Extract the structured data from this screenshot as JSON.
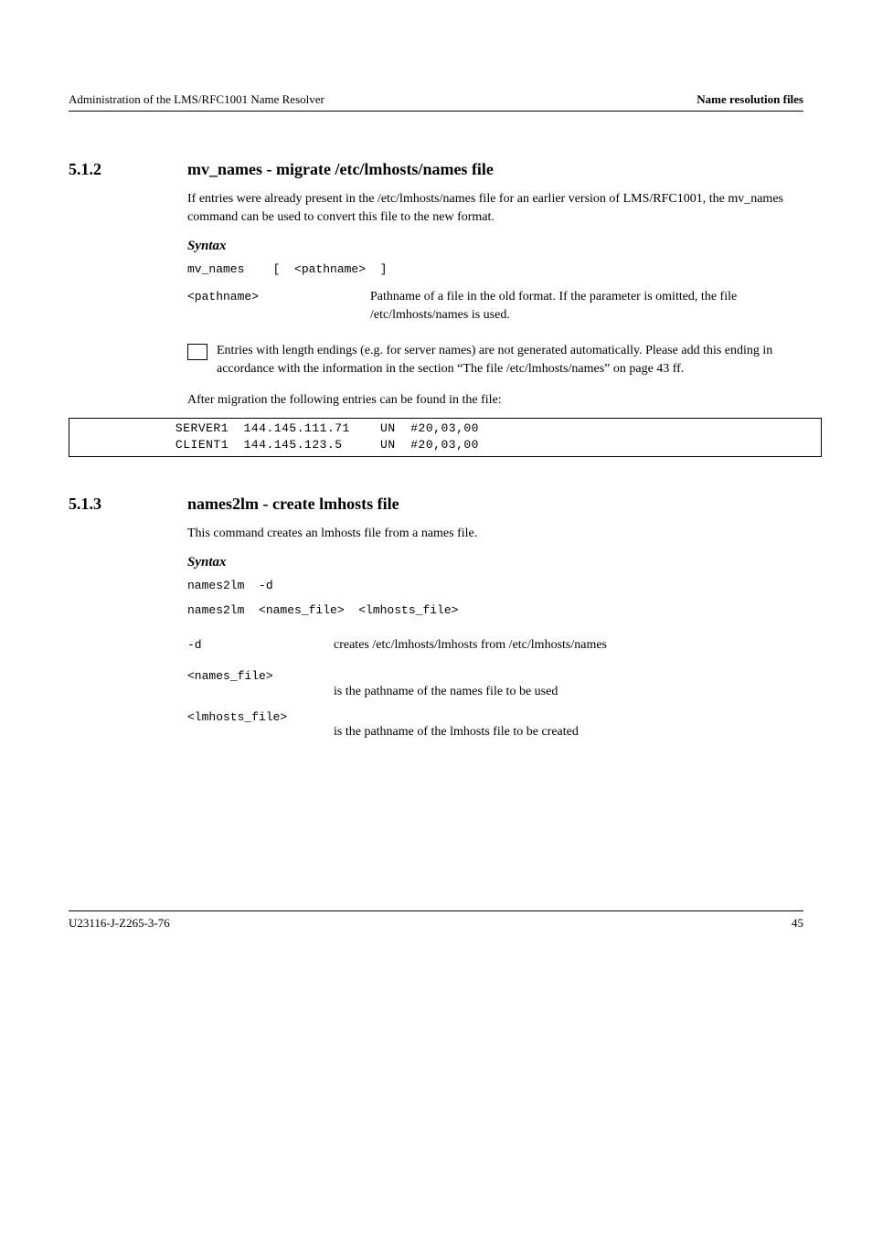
{
  "header": {
    "left": "Administration of the LMS/RFC1001 Name Resolver",
    "right_label": "Name resolution files"
  },
  "s1": {
    "num": "5.1.2",
    "title": "mv_names - migrate /etc/lmhosts/names file",
    "intro": "If entries were already present in the /etc/lmhosts/names file for an earlier version of LMS/RFC1001, the mv_names command can be used to convert this file to the new format.",
    "syntax_label": "Syntax",
    "syntax": "mv_names    [  <pathname>  ]",
    "p_key": "<pathname>",
    "p_val": "Pathname of a file in the old format. If the parameter is omitted, the file /etc/lmhosts/names is used.",
    "note": "Entries with length endings (e.g. for server names) are not generated automatically. Please add this ending in accordance with the information in the section “The file /etc/lmhosts/names” on page 43 ff.",
    "after_label": "After migration the following entries can be found in the file:",
    "example": "             SERVER1  144.145.111.71    UN  #20,03,00\n             CLIENT1  144.145.123.5     UN  #20,03,00"
  },
  "s2": {
    "num": "5.1.3",
    "title": "names2lm - create lmhosts file",
    "intro": "This command creates an lmhosts file from a names file.",
    "syntax_label": "Syntax",
    "syntax1": "names2lm  -d",
    "syntax2": "names2lm  <names_file>  <lmhosts_file>",
    "d_key": "-d",
    "d_val": "creates /etc/lmhosts/lmhosts from /etc/lmhosts/names",
    "n_key": "<names_file>",
    "n_val": "is the pathname of the names file to be used",
    "l_key": "<lmhosts_file>",
    "l_val": "is the pathname of the lmhosts file to be created"
  },
  "footer": {
    "left": "U23116-J-Z265-3-76",
    "right": "45"
  }
}
